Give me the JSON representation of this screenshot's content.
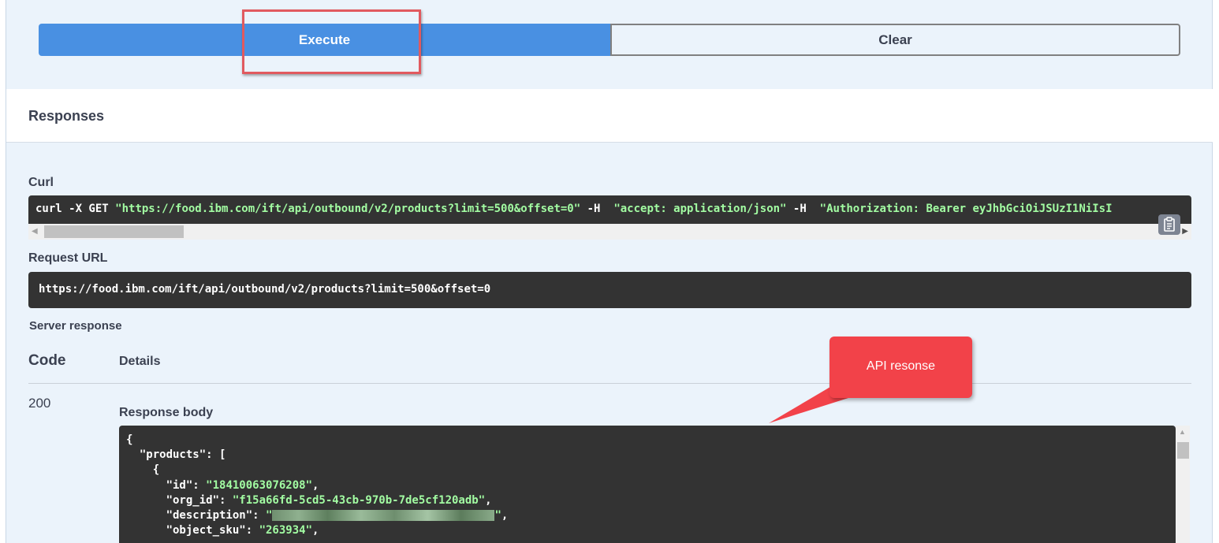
{
  "actions": {
    "execute_label": "Execute",
    "clear_label": "Clear"
  },
  "responses": {
    "title": "Responses"
  },
  "curl": {
    "label": "Curl",
    "cmd_prefix": "curl -X GET ",
    "url_quoted": "\"https://food.ibm.com/ift/api/outbound/v2/products?limit=500&offset=0\"",
    "flag1": " -H  ",
    "accept_header": "\"accept: application/json\"",
    "flag2": " -H  ",
    "auth_header": "\"Authorization: Bearer eyJhbGciOiJSUzI1NiIsI"
  },
  "request_url": {
    "label": "Request URL",
    "value": "https://food.ibm.com/ift/api/outbound/v2/products?limit=500&offset=0"
  },
  "server_response": {
    "label": "Server response",
    "col_code": "Code",
    "col_details": "Details",
    "status_code": "200",
    "body_label": "Response body"
  },
  "response_body": {
    "line1": "{",
    "line2_key": "  \"products\": [",
    "line3": "    {",
    "id_key": "      \"id\": ",
    "id_val": "\"18410063076208\"",
    "org_key": "      \"org_id\": ",
    "org_val": "\"f15a66fd-5cd5-43cb-970b-7de5cf120adb\"",
    "desc_key": "      \"description\": ",
    "desc_open": "\"",
    "desc_close": "\"",
    "sku_key": "      \"object_sku\": ",
    "sku_val": "\"263934\""
  },
  "callout": {
    "text": "API resonse"
  },
  "colors": {
    "execute": "#4990e2",
    "panel_bg": "#ebf3fb",
    "code_bg": "#333333",
    "string_green": "#a2fca2",
    "callout_red": "#f24249",
    "highlight_red": "#e15a5f"
  }
}
